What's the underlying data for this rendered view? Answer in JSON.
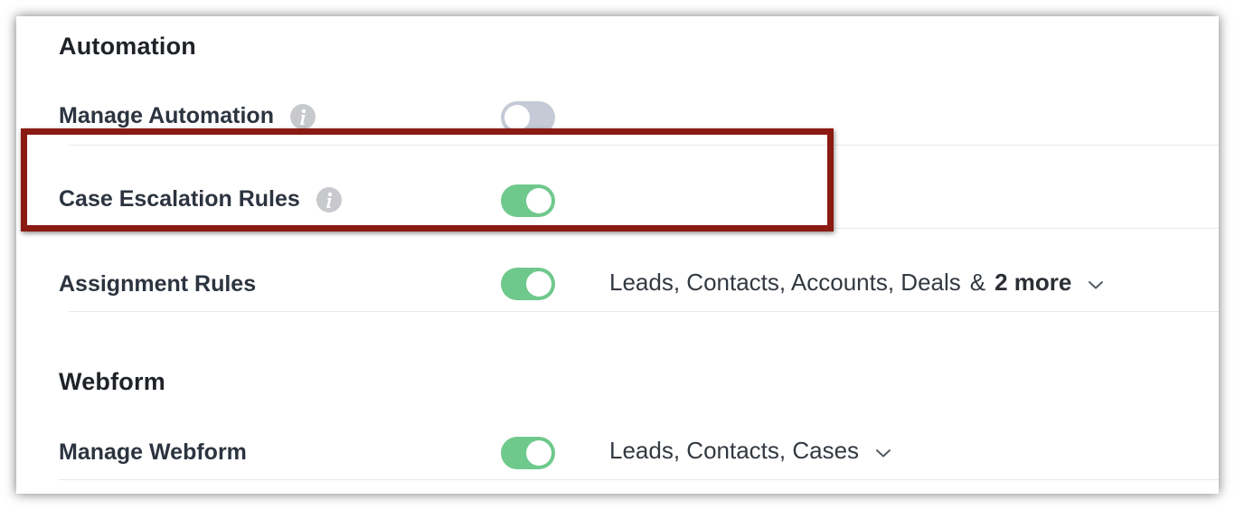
{
  "colors": {
    "toggle_on": "#6fc98c",
    "toggle_off": "#c5cad6",
    "highlight_border": "#8b1a12",
    "info_icon": "#c8c9cc"
  },
  "automation": {
    "title": "Automation",
    "rows": [
      {
        "label": "Manage Automation",
        "has_info_icon": true,
        "enabled": false
      },
      {
        "label": "Case Escalation Rules",
        "has_info_icon": true,
        "enabled": true,
        "highlighted": true
      },
      {
        "label": "Assignment Rules",
        "has_info_icon": false,
        "enabled": true,
        "modules": {
          "text": "Leads, Contacts, Accounts, Deals",
          "amp": "&",
          "more": "2 more"
        }
      }
    ]
  },
  "webform": {
    "title": "Webform",
    "rows": [
      {
        "label": "Manage Webform",
        "has_info_icon": false,
        "enabled": true,
        "modules": {
          "text": "Leads, Contacts, Cases"
        }
      }
    ]
  },
  "icons": {
    "info": "info-icon",
    "dropdown": "chevron-down-icon"
  }
}
